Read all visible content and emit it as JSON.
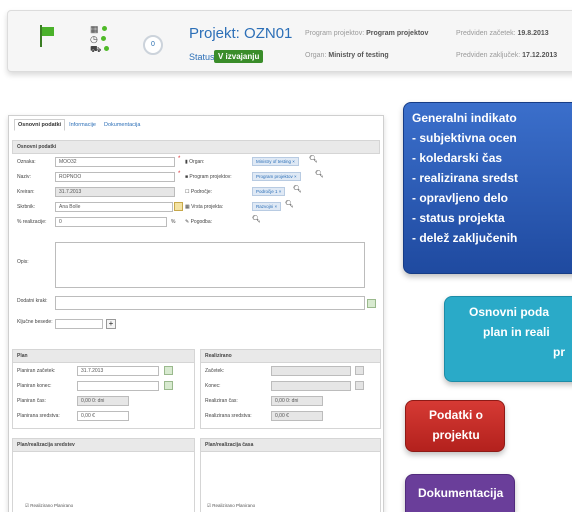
{
  "header": {
    "project_label": "Projekt:",
    "project_code": "OZN01",
    "status_label": "Status:",
    "status_value": "V izvajanju",
    "progress_value": "0",
    "program_label": "Program projektov:",
    "program_value": "Program projektov",
    "organ_label": "Organ:",
    "organ_value": "Ministry of testing",
    "start_label": "Predviden začetek:",
    "start_value": "19.8.2013",
    "end_label": "Predviden zaključek:",
    "end_value": "17.12.2013",
    "icons": [
      "flag-icon",
      "grid-icon",
      "clock-icon",
      "cart-icon"
    ],
    "status_color": "#3a8d2a"
  },
  "form": {
    "tabs": [
      "Osnovni podatki",
      "Informacije",
      "Dokumentacija"
    ],
    "section_basic": "Osnovni podatki",
    "fields": {
      "oznaka_label": "Oznaka:",
      "oznaka_value": "MOO32",
      "naziv_label": "Naziv:",
      "naziv_value": "ROPNOO",
      "kreiran_label": "Kreiran:",
      "kreiran_value": "31.7.2013",
      "skrbnik_label": "Skrbnik:",
      "skrbnik_value": "Ana Bolle",
      "realizacija_label": "% realizacije:",
      "realizacija_value": "0",
      "opis_label": "Opis:",
      "dodatni_label": "Dodatni kraki:",
      "kljucne_label": "Ključne besede:",
      "organ_label": "Organ:",
      "organ_value": "Ministry of testing ×",
      "program_label": "Program projektov:",
      "program_value": "Program projektov ×",
      "podrocje_label": "Področje:",
      "podrocje_value": "Področje 1 ×",
      "vrsta_label": "Vrsta projekta:",
      "vrsta_value": "Razvojni ×",
      "pogodba_label": "Pogodba:"
    },
    "plan": {
      "title": "Plan",
      "zacetek_label": "Planiran začetek:",
      "zacetek_value": "31.7.2013",
      "konec_label": "Planiran konec:",
      "cas_label": "Planiran čas:",
      "cas_value": "0,00 0: dni",
      "sredstva_label": "Planirana sredstva:",
      "sredstva_value": "0,00 €"
    },
    "realizirano": {
      "title": "Realizirano",
      "zacetek_label": "Začetek:",
      "konec_label": "Konec:",
      "cas_label": "Realiziran čas:",
      "cas_value": "0,00 0: dni",
      "sredstva_label": "Realizirana sredstva:",
      "sredstva_value": "0,00 €"
    },
    "chart_sredstev": "Plan/realizacija sredstev",
    "chart_casa": "Plan/realizacija časa",
    "legend": "Realizirano  Planirano"
  },
  "callouts": {
    "indicators_title": "Generalni indikato",
    "indicators": [
      "- subjektivna ocen",
      "- koledarski čas",
      "- realizirana sredst",
      "- opravljeno delo",
      "- status projekta",
      "- delež zaključenih"
    ],
    "basic_lines": [
      "Osnovni poda",
      "plan in reali",
      "pr"
    ],
    "project_lines": [
      "Podatki o",
      "projektu"
    ],
    "doc_label": "Dokumentacija",
    "colors": {
      "blue": "#2a5bb8",
      "teal": "#2aaac8",
      "red": "#c52a25",
      "purple": "#6a3e9a"
    }
  }
}
